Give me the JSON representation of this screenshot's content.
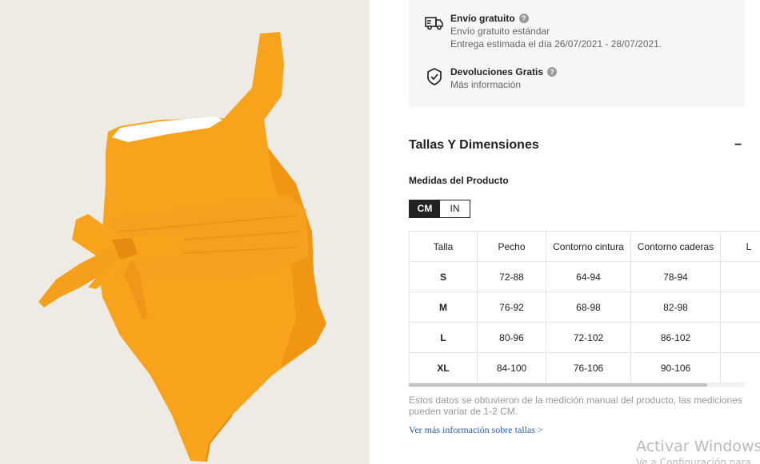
{
  "product": {
    "image_name": "orange one-shoulder tie-waist swimsuit",
    "background_color": "#eeebe4",
    "swimsuit_color": "#f9a21b"
  },
  "shipping": {
    "free_shipping": {
      "title": "Envío gratuito",
      "line1": "Envío gratuito estándar",
      "line2": "Entrega estimada el día 26/07/2021 - 28/07/2021.",
      "icon": "truck-icon",
      "help_icon": "?"
    },
    "returns": {
      "title": "Devoluciones Gratis",
      "line1": "Más información",
      "icon": "shield-check-icon",
      "help_icon": "?"
    }
  },
  "sizes_section": {
    "title": "Tallas Y Dimensiones",
    "collapse_symbol": "−",
    "measure_label": "Medidas del Producto",
    "units": [
      "CM",
      "IN"
    ],
    "active_unit": "CM",
    "table": {
      "headers": [
        "Talla",
        "Pecho",
        "Contorno cintura",
        "Contorno caderas",
        "L"
      ],
      "rows": [
        [
          "S",
          "72-88",
          "64-94",
          "78-94",
          ""
        ],
        [
          "M",
          "76-92",
          "68-98",
          "82-98",
          ""
        ],
        [
          "L",
          "80-96",
          "72-102",
          "86-102",
          ""
        ],
        [
          "XL",
          "84-100",
          "76-106",
          "90-106",
          ""
        ]
      ]
    },
    "note": "Estos datos se obtuvieron de la medición manual del producto, las mediciones pueden variar de 1-2 CM.",
    "more_link": "Ver más información sobre tallas >"
  },
  "watermark": {
    "line1": "Activar Windows",
    "line2": "Ve a Configuración para"
  }
}
